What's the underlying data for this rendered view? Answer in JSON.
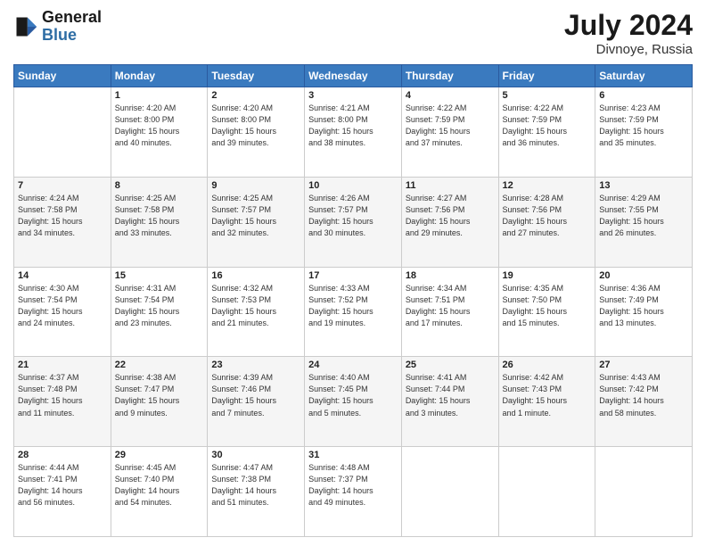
{
  "logo": {
    "line1": "General",
    "line2": "Blue"
  },
  "title": "July 2024",
  "location": "Divnoye, Russia",
  "days_header": [
    "Sunday",
    "Monday",
    "Tuesday",
    "Wednesday",
    "Thursday",
    "Friday",
    "Saturday"
  ],
  "weeks": [
    [
      {
        "day": "",
        "info": ""
      },
      {
        "day": "1",
        "info": "Sunrise: 4:20 AM\nSunset: 8:00 PM\nDaylight: 15 hours\nand 40 minutes."
      },
      {
        "day": "2",
        "info": "Sunrise: 4:20 AM\nSunset: 8:00 PM\nDaylight: 15 hours\nand 39 minutes."
      },
      {
        "day": "3",
        "info": "Sunrise: 4:21 AM\nSunset: 8:00 PM\nDaylight: 15 hours\nand 38 minutes."
      },
      {
        "day": "4",
        "info": "Sunrise: 4:22 AM\nSunset: 7:59 PM\nDaylight: 15 hours\nand 37 minutes."
      },
      {
        "day": "5",
        "info": "Sunrise: 4:22 AM\nSunset: 7:59 PM\nDaylight: 15 hours\nand 36 minutes."
      },
      {
        "day": "6",
        "info": "Sunrise: 4:23 AM\nSunset: 7:59 PM\nDaylight: 15 hours\nand 35 minutes."
      }
    ],
    [
      {
        "day": "7",
        "info": "Sunrise: 4:24 AM\nSunset: 7:58 PM\nDaylight: 15 hours\nand 34 minutes."
      },
      {
        "day": "8",
        "info": "Sunrise: 4:25 AM\nSunset: 7:58 PM\nDaylight: 15 hours\nand 33 minutes."
      },
      {
        "day": "9",
        "info": "Sunrise: 4:25 AM\nSunset: 7:57 PM\nDaylight: 15 hours\nand 32 minutes."
      },
      {
        "day": "10",
        "info": "Sunrise: 4:26 AM\nSunset: 7:57 PM\nDaylight: 15 hours\nand 30 minutes."
      },
      {
        "day": "11",
        "info": "Sunrise: 4:27 AM\nSunset: 7:56 PM\nDaylight: 15 hours\nand 29 minutes."
      },
      {
        "day": "12",
        "info": "Sunrise: 4:28 AM\nSunset: 7:56 PM\nDaylight: 15 hours\nand 27 minutes."
      },
      {
        "day": "13",
        "info": "Sunrise: 4:29 AM\nSunset: 7:55 PM\nDaylight: 15 hours\nand 26 minutes."
      }
    ],
    [
      {
        "day": "14",
        "info": "Sunrise: 4:30 AM\nSunset: 7:54 PM\nDaylight: 15 hours\nand 24 minutes."
      },
      {
        "day": "15",
        "info": "Sunrise: 4:31 AM\nSunset: 7:54 PM\nDaylight: 15 hours\nand 23 minutes."
      },
      {
        "day": "16",
        "info": "Sunrise: 4:32 AM\nSunset: 7:53 PM\nDaylight: 15 hours\nand 21 minutes."
      },
      {
        "day": "17",
        "info": "Sunrise: 4:33 AM\nSunset: 7:52 PM\nDaylight: 15 hours\nand 19 minutes."
      },
      {
        "day": "18",
        "info": "Sunrise: 4:34 AM\nSunset: 7:51 PM\nDaylight: 15 hours\nand 17 minutes."
      },
      {
        "day": "19",
        "info": "Sunrise: 4:35 AM\nSunset: 7:50 PM\nDaylight: 15 hours\nand 15 minutes."
      },
      {
        "day": "20",
        "info": "Sunrise: 4:36 AM\nSunset: 7:49 PM\nDaylight: 15 hours\nand 13 minutes."
      }
    ],
    [
      {
        "day": "21",
        "info": "Sunrise: 4:37 AM\nSunset: 7:48 PM\nDaylight: 15 hours\nand 11 minutes."
      },
      {
        "day": "22",
        "info": "Sunrise: 4:38 AM\nSunset: 7:47 PM\nDaylight: 15 hours\nand 9 minutes."
      },
      {
        "day": "23",
        "info": "Sunrise: 4:39 AM\nSunset: 7:46 PM\nDaylight: 15 hours\nand 7 minutes."
      },
      {
        "day": "24",
        "info": "Sunrise: 4:40 AM\nSunset: 7:45 PM\nDaylight: 15 hours\nand 5 minutes."
      },
      {
        "day": "25",
        "info": "Sunrise: 4:41 AM\nSunset: 7:44 PM\nDaylight: 15 hours\nand 3 minutes."
      },
      {
        "day": "26",
        "info": "Sunrise: 4:42 AM\nSunset: 7:43 PM\nDaylight: 15 hours\nand 1 minute."
      },
      {
        "day": "27",
        "info": "Sunrise: 4:43 AM\nSunset: 7:42 PM\nDaylight: 14 hours\nand 58 minutes."
      }
    ],
    [
      {
        "day": "28",
        "info": "Sunrise: 4:44 AM\nSunset: 7:41 PM\nDaylight: 14 hours\nand 56 minutes."
      },
      {
        "day": "29",
        "info": "Sunrise: 4:45 AM\nSunset: 7:40 PM\nDaylight: 14 hours\nand 54 minutes."
      },
      {
        "day": "30",
        "info": "Sunrise: 4:47 AM\nSunset: 7:38 PM\nDaylight: 14 hours\nand 51 minutes."
      },
      {
        "day": "31",
        "info": "Sunrise: 4:48 AM\nSunset: 7:37 PM\nDaylight: 14 hours\nand 49 minutes."
      },
      {
        "day": "",
        "info": ""
      },
      {
        "day": "",
        "info": ""
      },
      {
        "day": "",
        "info": ""
      }
    ]
  ]
}
